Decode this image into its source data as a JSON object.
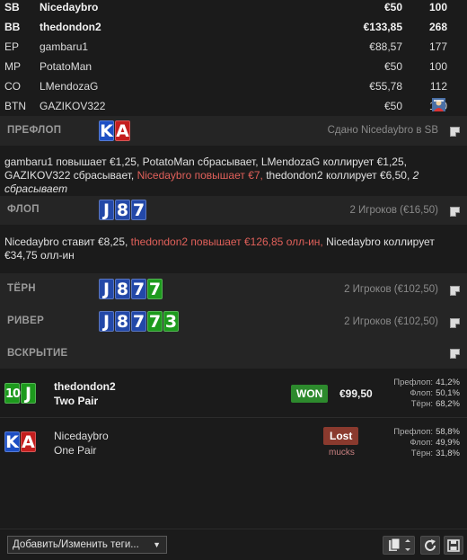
{
  "players": [
    {
      "pos": "SB",
      "name": "Nicedaybro",
      "stack": "€50",
      "bb": "100",
      "active": true,
      "is_hero": false
    },
    {
      "pos": "BB",
      "name": "thedondon2",
      "stack": "€133,85",
      "bb": "268",
      "active": true,
      "is_hero": false
    },
    {
      "pos": "EP",
      "name": "gambaru1",
      "stack": "€88,57",
      "bb": "177",
      "active": false,
      "is_hero": false
    },
    {
      "pos": "MP",
      "name": "PotatoMan",
      "stack": "€50",
      "bb": "100",
      "active": false,
      "is_hero": false
    },
    {
      "pos": "CO",
      "name": "LMendozaG",
      "stack": "€55,78",
      "bb": "112",
      "active": false,
      "is_hero": false
    },
    {
      "pos": "BTN",
      "name": "GAZIKOV322",
      "stack": "€50",
      "bb": "100",
      "active": false,
      "is_hero": true
    }
  ],
  "preflop": {
    "title": "ПРЕФЛОП",
    "info": "Сдано Nicedaybro в SB",
    "cards": [
      {
        "rank": "K",
        "suit": "diamonds"
      },
      {
        "rank": "A",
        "suit": "hearts"
      }
    ],
    "actions": [
      {
        "text": "gambaru1 повышает €1,25, PotatoMan сбрасывает, LMendozaG коллирует €1,25, GAZIKOV322 сбрасывает, ",
        "style": "normal"
      },
      {
        "text": "Nicedaybro повышает €7,",
        "style": "red"
      },
      {
        "text": " thedondon2 коллирует €6,50, ",
        "style": "normal"
      },
      {
        "text": "2 сбрасывает",
        "style": "italic"
      }
    ]
  },
  "flop": {
    "title": "ФЛОП",
    "info": "2 Игроков (€16,50)",
    "cards": [
      {
        "rank": "J",
        "suit": "spades"
      },
      {
        "rank": "8",
        "suit": "spades"
      },
      {
        "rank": "7",
        "suit": "spades"
      }
    ],
    "actions": [
      {
        "text": "Nicedaybro ставит €8,25, ",
        "style": "normal"
      },
      {
        "text": "thedondon2 повышает €126,85 олл-ин,",
        "style": "red"
      },
      {
        "text": " Nicedaybro коллирует €34,75 олл-ин",
        "style": "normal"
      }
    ]
  },
  "turn": {
    "title": "ТЁРН",
    "info": "2 Игроков (€102,50)",
    "cards": [
      {
        "rank": "J",
        "suit": "spades"
      },
      {
        "rank": "8",
        "suit": "spades"
      },
      {
        "rank": "7",
        "suit": "spades"
      },
      {
        "rank": "7",
        "suit": "clubs"
      }
    ]
  },
  "river": {
    "title": "РИВЕР",
    "info": "2 Игроков (€102,50)",
    "cards": [
      {
        "rank": "J",
        "suit": "spades"
      },
      {
        "rank": "8",
        "suit": "spades"
      },
      {
        "rank": "7",
        "suit": "spades"
      },
      {
        "rank": "7",
        "suit": "clubs"
      },
      {
        "rank": "3",
        "suit": "clubs"
      }
    ]
  },
  "showdown": {
    "title": "ВСКРЫТИЕ",
    "results": [
      {
        "cards": [
          {
            "rank": "10",
            "suit": "clubs"
          },
          {
            "rank": "J",
            "suit": "clubs"
          }
        ],
        "name": "thedondon2",
        "hand": "Two Pair",
        "badge": "WON",
        "amount": "€99,50",
        "equity": [
          {
            "label": "Префлоп:",
            "value": "41,2%"
          },
          {
            "label": "Флоп:",
            "value": "50,1%"
          },
          {
            "label": "Тёрн:",
            "value": "68,2%"
          }
        ]
      },
      {
        "cards": [
          {
            "rank": "K",
            "suit": "diamonds"
          },
          {
            "rank": "A",
            "suit": "hearts"
          }
        ],
        "name": "Nicedaybro",
        "hand": "One Pair",
        "badge": "Lost",
        "note": "mucks",
        "equity": [
          {
            "label": "Префлоп:",
            "value": "58,8%"
          },
          {
            "label": "Флоп:",
            "value": "49,9%"
          },
          {
            "label": "Тёрн:",
            "value": "31,8%"
          }
        ]
      }
    ]
  },
  "footer": {
    "tags_label": "Добавить/Изменить теги...",
    "buttons": [
      "copy-icon",
      "refresh-icon",
      "save-icon"
    ]
  },
  "colors": {
    "won": "#2d8a2d",
    "lost": "#8a3a2e",
    "raise_text": "#e0605a",
    "clubs": "#1d9a1d",
    "spades": "#2348a8",
    "hearts": "#c41e1e",
    "diamonds": "#1d4fc4"
  }
}
